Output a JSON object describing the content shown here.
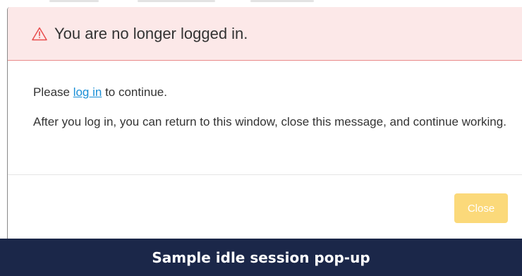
{
  "dialog": {
    "title": "You are no longer logged in.",
    "warning_icon": "warning-triangle-icon",
    "body": {
      "para1_before": "Please ",
      "login_link": "log in",
      "para1_after": " to continue.",
      "para2": "After you log in, you can return to this window, close this message, and continue working."
    },
    "close_label": "Close"
  },
  "caption": "Sample idle session pop-up",
  "colors": {
    "header_bg": "#fce8e8",
    "header_border": "#e98b8b",
    "warning_icon": "#e84d4d",
    "link": "#1a8fd6",
    "close_button": "#fbd97a",
    "caption_bg": "#1b2749"
  }
}
